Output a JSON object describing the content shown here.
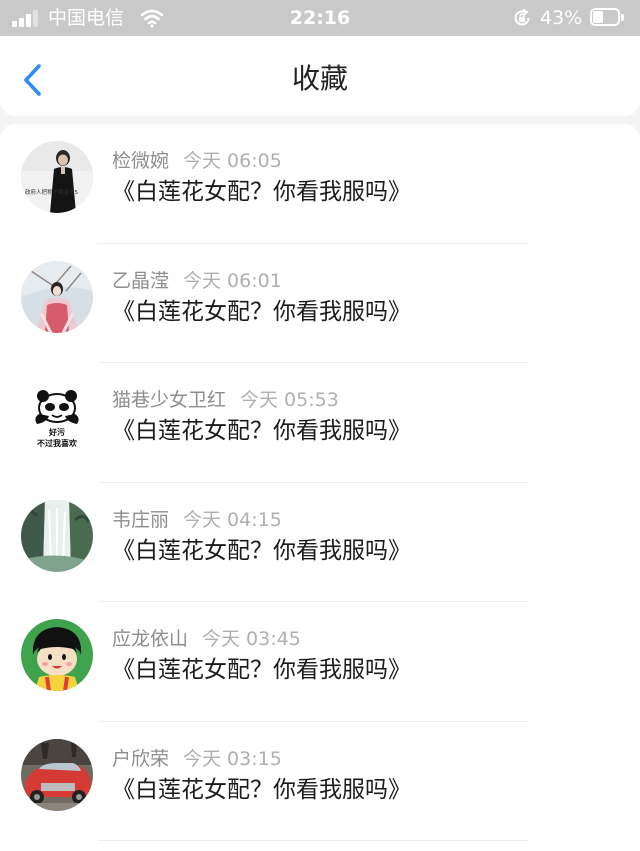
{
  "status_bar": {
    "carrier": "中国电信",
    "time": "22:16",
    "battery_percent_text": "43%",
    "battery_level": 0.43,
    "signal_bars_active": 3,
    "signal_bars_total": 4,
    "icons": [
      "signal-icon",
      "wifi-icon",
      "rotation-lock-icon",
      "battery-icon"
    ]
  },
  "nav": {
    "title": "收藏",
    "back_icon": "chevron-left-icon",
    "accent_color": "#2f8ef0"
  },
  "favorites": [
    {
      "user": "检微婉",
      "time": "今天 06:05",
      "title": "《白莲花女配？你看我服吗》",
      "avatar": "photo-woman-black-outfit",
      "avatar_caption": "政府人把称不晚金过5"
    },
    {
      "user": "乙晶滢",
      "time": "今天 06:01",
      "title": "《白莲花女配？你看我服吗》",
      "avatar": "photo-girl-hanfu-snow"
    },
    {
      "user": "猫巷少女卫红",
      "time": "今天 05:53",
      "title": "《白莲花女配？你看我服吗》",
      "avatar": "panda-meme",
      "avatar_caption_line1": "好污",
      "avatar_caption_line2": "不过我喜欢"
    },
    {
      "user": "韦庄丽",
      "time": "今天 04:15",
      "title": "《白莲花女配？你看我服吗》",
      "avatar": "photo-waterfall-cliffs"
    },
    {
      "user": "应龙依山",
      "time": "今天 03:45",
      "title": "《白莲花女配？你看我服吗》",
      "avatar": "cartoon-girl"
    },
    {
      "user": "户欣荣",
      "time": "今天 03:15",
      "title": "《白莲花女配？你看我服吗》",
      "avatar": "photo-red-car"
    }
  ],
  "colors": {
    "status_bar_bg": "#c9c9c9",
    "page_bg": "#f4f4f4",
    "name_color": "#8e8e8e",
    "time_color": "#b0b0b0",
    "title_color": "#1b1b1b"
  }
}
